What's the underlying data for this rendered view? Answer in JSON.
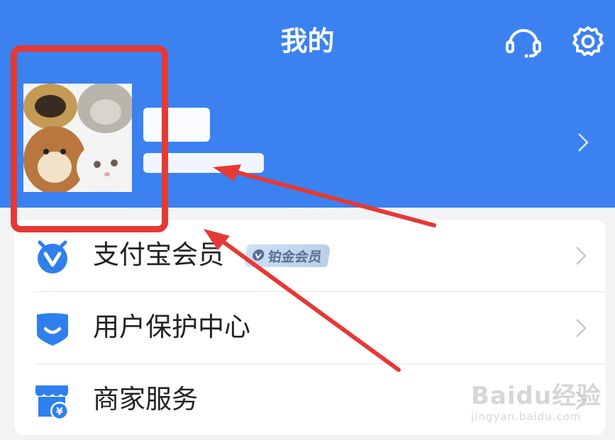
{
  "header": {
    "title": "我的",
    "colors": {
      "background": "#3b82f0",
      "title": "#ffffff"
    },
    "icons": [
      "customer-service-icon",
      "settings-icon"
    ]
  },
  "profile": {
    "avatar": "avatar-image",
    "name_redacted": true,
    "account_redacted": true,
    "chevron": "chevron-right-icon"
  },
  "menu": {
    "items": [
      {
        "label": "支付宝会员",
        "icon": "member-v-icon",
        "badge": "铂金会员"
      },
      {
        "label": "用户保护中心",
        "icon": "shield-icon"
      },
      {
        "label": "商家服务",
        "icon": "store-icon"
      }
    ]
  },
  "annotations": {
    "highlight_color": "#e53935"
  },
  "watermark": {
    "brand": "Baidu经验",
    "url": "jingyan.baidu.com"
  }
}
